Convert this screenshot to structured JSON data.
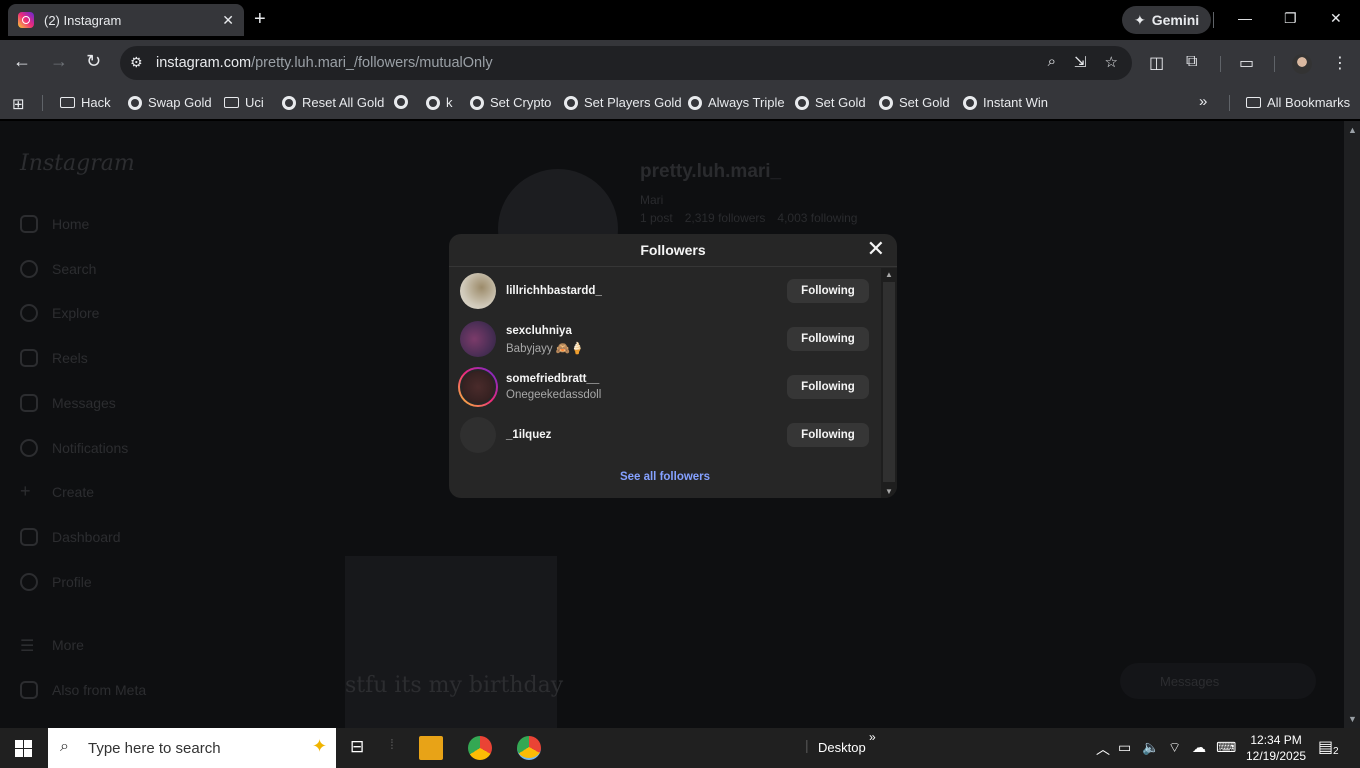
{
  "browser": {
    "tab_title": "(2) Instagram",
    "tab_close": "✕",
    "new_tab": "+",
    "gemini_label": "Gemini",
    "url_host": "instagram.com",
    "url_path": "/pretty.luh.mari_/followers/mutualOnly"
  },
  "bookmarks": {
    "items": [
      {
        "label": "Hack",
        "icon": "folder"
      },
      {
        "label": "Swap Gold",
        "icon": "globe"
      },
      {
        "label": "Uci",
        "icon": "folder"
      },
      {
        "label": "Reset All Gold",
        "icon": "globe"
      },
      {
        "label": "",
        "icon": "globe"
      },
      {
        "label": "k",
        "icon": "globe"
      },
      {
        "label": "Set Crypto",
        "icon": "globe"
      },
      {
        "label": "Set Players Gold",
        "icon": "globe"
      },
      {
        "label": "Always Triple",
        "icon": "globe"
      },
      {
        "label": "Set Gold",
        "icon": "globe"
      },
      {
        "label": "Set Gold",
        "icon": "globe"
      },
      {
        "label": "Instant Win",
        "icon": "globe"
      }
    ],
    "overflow": "»",
    "all_bookmarks": "All Bookmarks"
  },
  "sidebar": {
    "logo": "Instagram",
    "items": [
      "Home",
      "Search",
      "Explore",
      "Reels",
      "Messages",
      "Notifications",
      "Create",
      "Dashboard",
      "Profile",
      "More",
      "Also from Meta"
    ]
  },
  "profile": {
    "username": "pretty.luh.mari_",
    "name": "Mari",
    "posts": "1 post",
    "followers": "2,319 followers",
    "following": "4,003 following",
    "post_caption": "stfu its my birthday",
    "messages_pill": "Messages"
  },
  "modal": {
    "title": "Followers",
    "close": "✕",
    "followers": [
      {
        "username": "lillrichhbastardd_",
        "subtitle": "",
        "button": "Following"
      },
      {
        "username": "sexcluhniya",
        "subtitle": "Babyjayy 🙈🍦",
        "button": "Following"
      },
      {
        "username": "somefriedbratt__",
        "subtitle": "Onegeekedassdoll",
        "button": "Following"
      },
      {
        "username": "_1ilquez",
        "subtitle": "",
        "button": "Following"
      }
    ],
    "see_all": "See all followers"
  },
  "taskbar": {
    "search_placeholder": "Type here to search",
    "desktop_label": "Desktop",
    "time": "12:34 PM",
    "date": "12/19/2025",
    "notification_count": "2"
  }
}
